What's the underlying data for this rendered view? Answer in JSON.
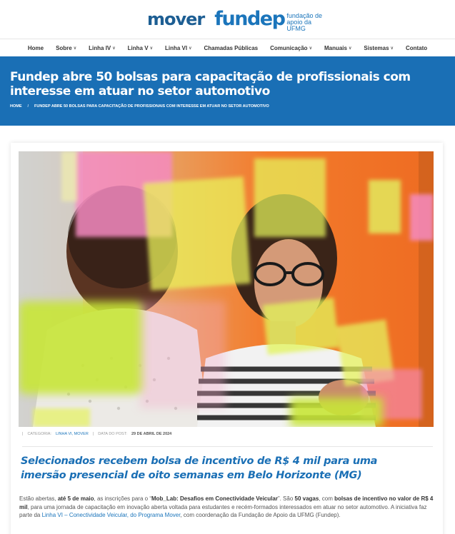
{
  "header": {
    "logo_mover": "mover",
    "logo_fundep": "fundep",
    "logo_fundep_sub": "fundação de apoio da UFMG"
  },
  "nav": [
    {
      "label": "Home",
      "dropdown": false
    },
    {
      "label": "Sobre",
      "dropdown": true
    },
    {
      "label": "Linha IV",
      "dropdown": true
    },
    {
      "label": "Linha V",
      "dropdown": true
    },
    {
      "label": "Linha VI",
      "dropdown": true
    },
    {
      "label": "Chamadas Públicas",
      "dropdown": false
    },
    {
      "label": "Comunicação",
      "dropdown": true
    },
    {
      "label": "Manuais",
      "dropdown": true
    },
    {
      "label": "Sistemas",
      "dropdown": true
    },
    {
      "label": "Contato",
      "dropdown": false
    }
  ],
  "hero": {
    "title": "Fundep abre 50 bolsas para capacitação de profissionais com interesse em atuar no setor automotivo",
    "breadcrumb_home": "HOME",
    "breadcrumb_sep": "/",
    "breadcrumb_current": "FUNDEP ABRE 50 BOLSAS PARA CAPACITAÇÃO DE PROFISSIONAIS COM INTERESSE EM ATUAR NO SETOR AUTOMOTIVO"
  },
  "post": {
    "category_label": "CATEGORIA:",
    "category_value": "LINHA VI, MOVER",
    "date_label": "DATA DO POST:",
    "date_value": "29 DE ABRIL DE 2024",
    "subtitle": " Selecionados recebem bolsa de incentivo de R$ 4 mil para uma imersão presencial de oito semanas em Belo Horizonte (MG)",
    "p1": "Estão abertas, ",
    "p2": "até 5 de maio",
    "p3": ", as inscrições para o “",
    "p4": "Mob_Lab: Desafios em Conectividade Veicular",
    "p5": "”. São ",
    "p6": "50 vagas",
    "p7": ", com ",
    "p8": "bolsas de incentivo no valor de R$ 4 mil",
    "p9": ", para uma jornada de capacitação em inovação aberta voltada para estudantes e recém-formados interessados em atuar no setor automotivo. A iniciativa faz parte da ",
    "p10": "Linha VI – Conectividade Veicular, do Programa Mover",
    "p11": ", com coordenação da Fundação de Apoio da UFMG (Fundep)."
  },
  "colors": {
    "brand_blue": "#1a6fb5",
    "mover_teal": "#19a8b3",
    "photo_orange": "#f07a2f",
    "sticky_pink": "#f58ac0",
    "sticky_yellow": "#dff25a"
  },
  "icons": {
    "nav_dropdown": "chevron-down-icon"
  }
}
